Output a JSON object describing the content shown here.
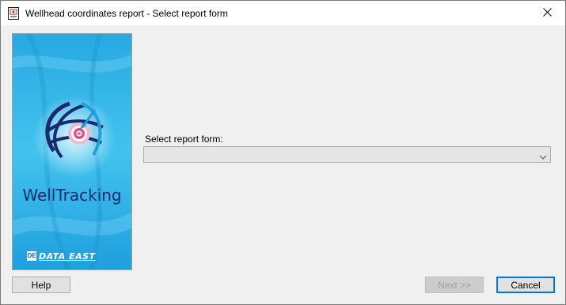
{
  "window": {
    "title": "Wellhead coordinates report - Select report form"
  },
  "banner": {
    "brand_name": "WellTracking",
    "company_name": "DATA EAST",
    "company_mark": "DE"
  },
  "form": {
    "select_label": "Select report form:",
    "select_value": ""
  },
  "buttons": {
    "help": "Help",
    "next": "Next >>",
    "cancel": "Cancel"
  },
  "colors": {
    "accent": "#0078d7",
    "banner_blue": "#29b6e8",
    "brand_text": "#1a2a6e",
    "target_pink": "#e0508a"
  }
}
